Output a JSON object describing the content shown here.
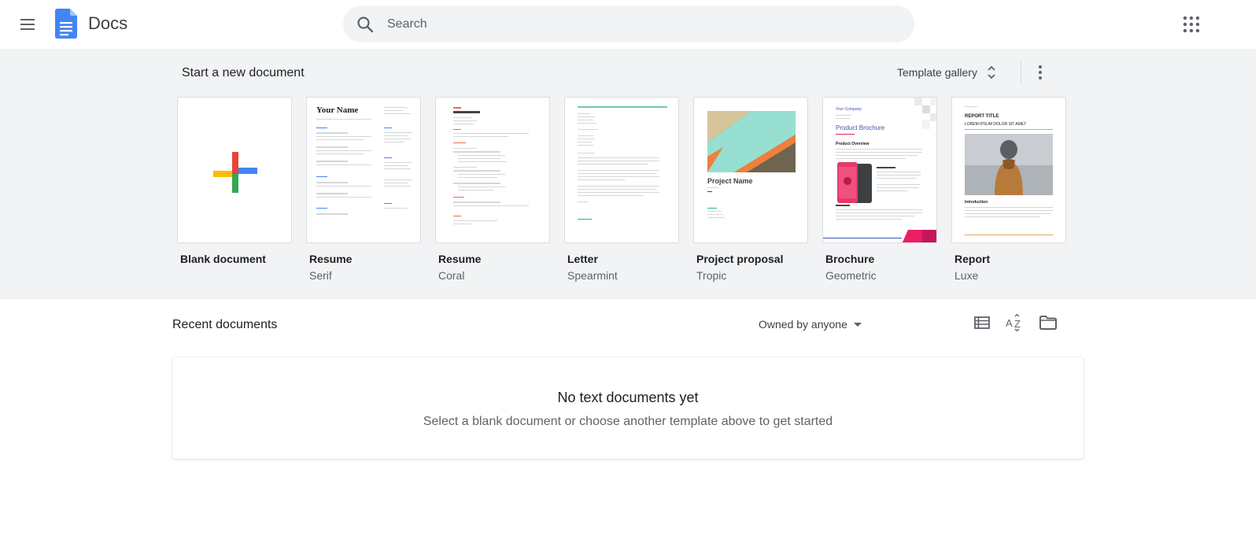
{
  "header": {
    "app_title": "Docs",
    "search_placeholder": "Search"
  },
  "templates": {
    "section_title": "Start a new document",
    "gallery_label": "Template gallery",
    "items": [
      {
        "name": "Blank document",
        "sub": ""
      },
      {
        "name": "Resume",
        "sub": "Serif"
      },
      {
        "name": "Resume",
        "sub": "Coral"
      },
      {
        "name": "Letter",
        "sub": "Spearmint"
      },
      {
        "name": "Project proposal",
        "sub": "Tropic"
      },
      {
        "name": "Brochure",
        "sub": "Geometric"
      },
      {
        "name": "Report",
        "sub": "Luxe"
      }
    ],
    "thumb_text": {
      "serif_heading": "Your Name",
      "proposal_heading": "Project Name",
      "brochure_company": "Your Company",
      "brochure_heading": "Product Brochure",
      "brochure_subheading": "Product Overview",
      "report_title": "REPORT TITLE",
      "report_subtitle": "LOREM IPSUM DOLOR SIT AMET",
      "report_section": "Introduction"
    }
  },
  "recent": {
    "title": "Recent documents",
    "owner_filter": "Owned by anyone",
    "empty_title": "No text documents yet",
    "empty_subtitle": "Select a blank document or choose another template above to get started"
  },
  "colors": {
    "docs_blue": "#4285f4",
    "google_red": "#ea4335",
    "google_yellow": "#fbbc04",
    "google_green": "#34a853",
    "section_bg": "#f1f3f4"
  }
}
